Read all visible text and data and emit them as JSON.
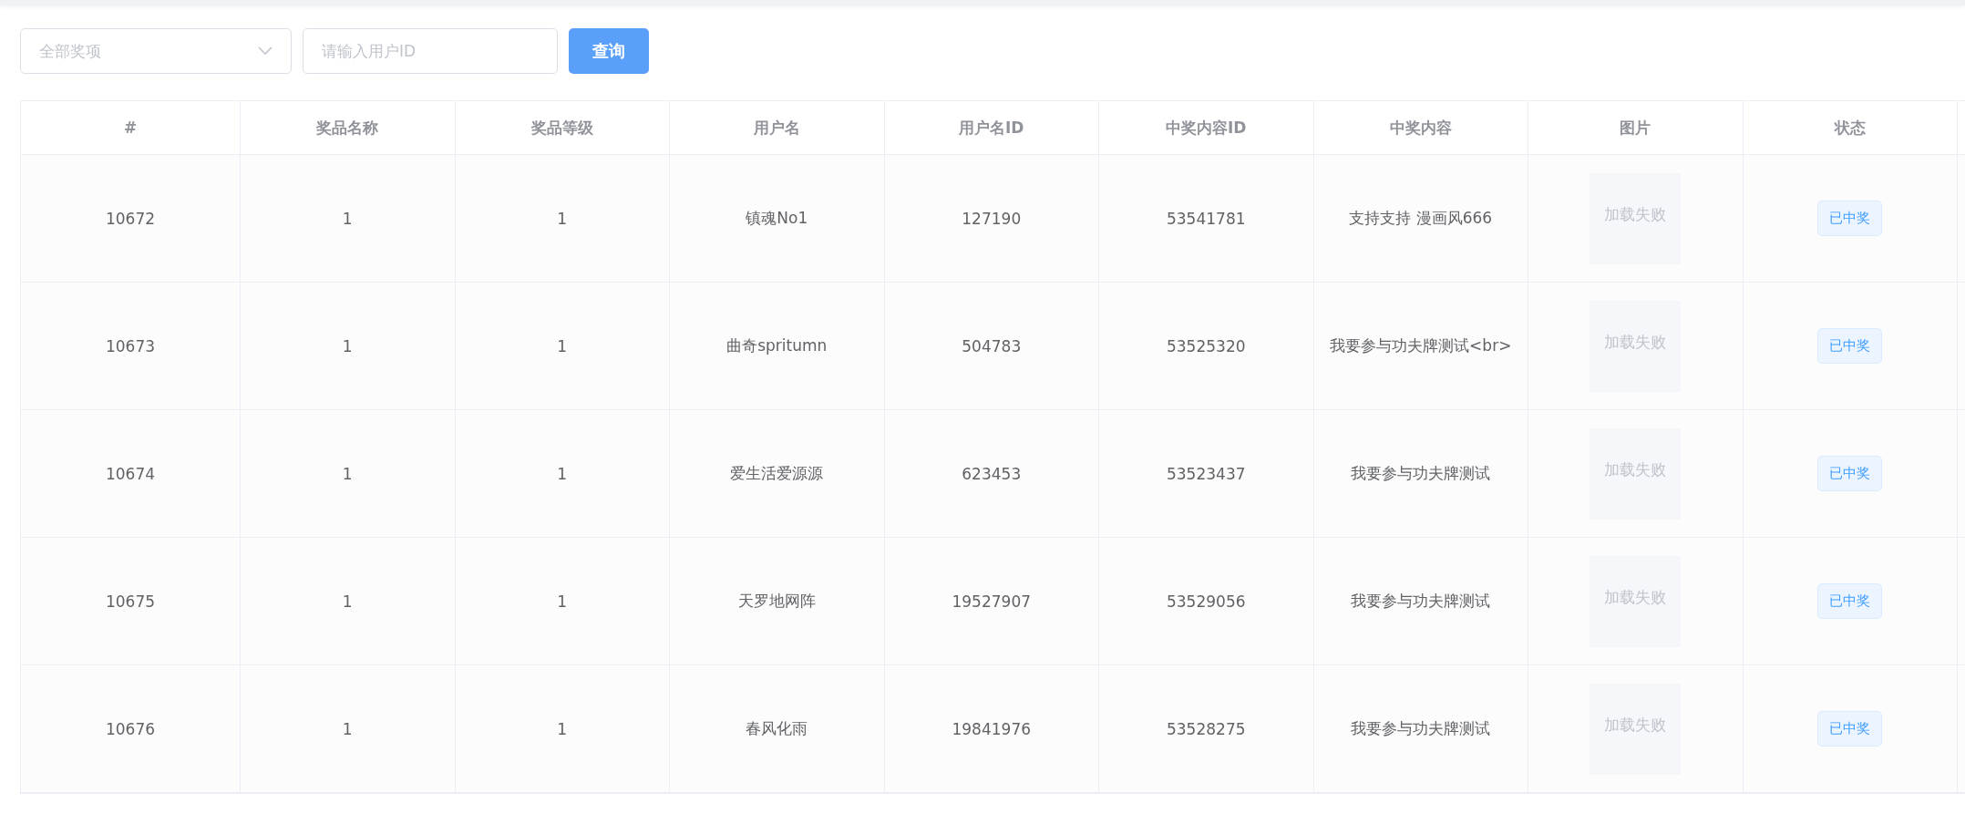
{
  "filters": {
    "prize_select": {
      "placeholder": "全部奖项"
    },
    "user_id": {
      "placeholder": "请输入用户ID"
    },
    "query_button": "查询"
  },
  "table": {
    "columns": [
      "#",
      "奖品名称",
      "奖品等级",
      "用户名",
      "用户名ID",
      "中奖内容ID",
      "中奖内容",
      "图片",
      "状态"
    ],
    "rows": [
      {
        "id": "10672",
        "prize_name": "1",
        "prize_level": "1",
        "username": "镇魂No1",
        "user_id": "127190",
        "content_id": "53541781",
        "content": "支持支持 漫画风666",
        "image": "加载失败",
        "status": "已中奖"
      },
      {
        "id": "10673",
        "prize_name": "1",
        "prize_level": "1",
        "username": "曲奇spritumn",
        "user_id": "504783",
        "content_id": "53525320",
        "content": "我要参与功夫牌测试<br>",
        "image": "加载失败",
        "status": "已中奖"
      },
      {
        "id": "10674",
        "prize_name": "1",
        "prize_level": "1",
        "username": "爱生活爱源源",
        "user_id": "623453",
        "content_id": "53523437",
        "content": "我要参与功夫牌测试",
        "image": "加载失败",
        "status": "已中奖"
      },
      {
        "id": "10675",
        "prize_name": "1",
        "prize_level": "1",
        "username": "天罗地网阵",
        "user_id": "19527907",
        "content_id": "53529056",
        "content": "我要参与功夫牌测试",
        "image": "加载失败",
        "status": "已中奖"
      },
      {
        "id": "10676",
        "prize_name": "1",
        "prize_level": "1",
        "username": "春风化雨",
        "user_id": "19841976",
        "content_id": "53528275",
        "content": "我要参与功夫牌测试",
        "image": "加载失败",
        "status": "已中奖"
      }
    ]
  }
}
